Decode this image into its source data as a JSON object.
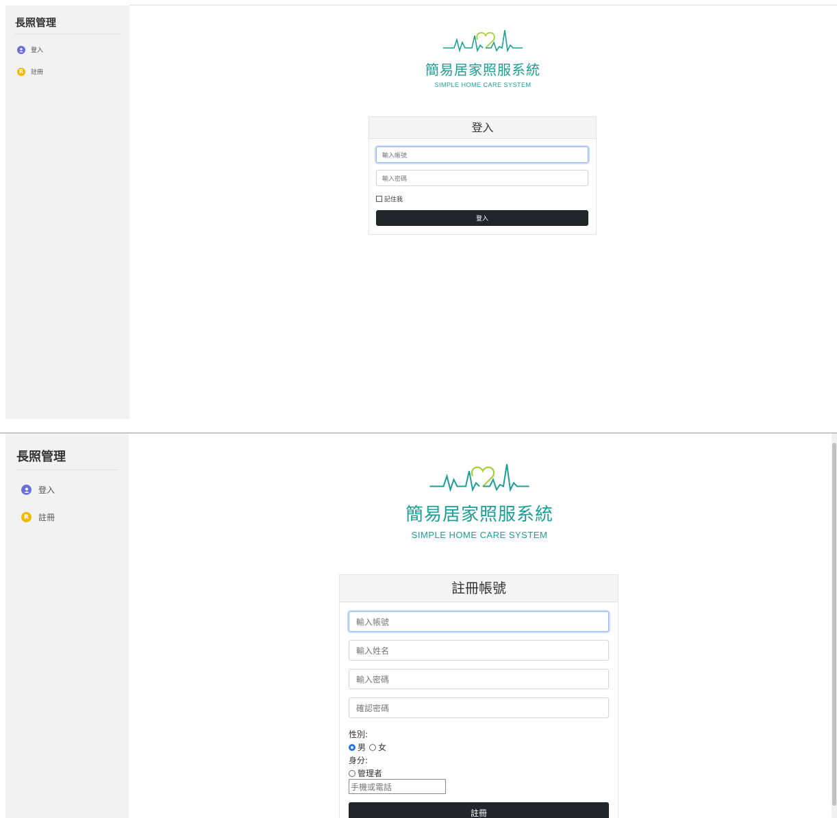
{
  "sidebar": {
    "brand": "長照管理",
    "items": [
      {
        "label": "登入",
        "icon": "user-circle-icon"
      },
      {
        "label": "註冊",
        "icon": "register-badge-icon",
        "badge": "R"
      }
    ]
  },
  "logo": {
    "title": "簡易居家照服系統",
    "subtitle": "SIMPLE HOME CARE SYSTEM",
    "colors": {
      "teal": "#1a9e97",
      "heart": "#a6cf3c"
    }
  },
  "login": {
    "header": "登入",
    "username_placeholder": "輸入帳號",
    "password_placeholder": "輸入密碼",
    "remember_label": "記住我",
    "submit_label": "登入"
  },
  "register": {
    "header": "註冊帳號",
    "username_placeholder": "輸入帳號",
    "name_placeholder": "輸入姓名",
    "password_placeholder": "輸入密碼",
    "confirm_placeholder": "確認密碼",
    "gender_label": "性別:",
    "gender_options": [
      "男",
      "女"
    ],
    "gender_selected": "男",
    "role_label": "身分:",
    "role_option": "管理者",
    "phone_placeholder": "手機或電話",
    "submit_label": "註冊"
  }
}
